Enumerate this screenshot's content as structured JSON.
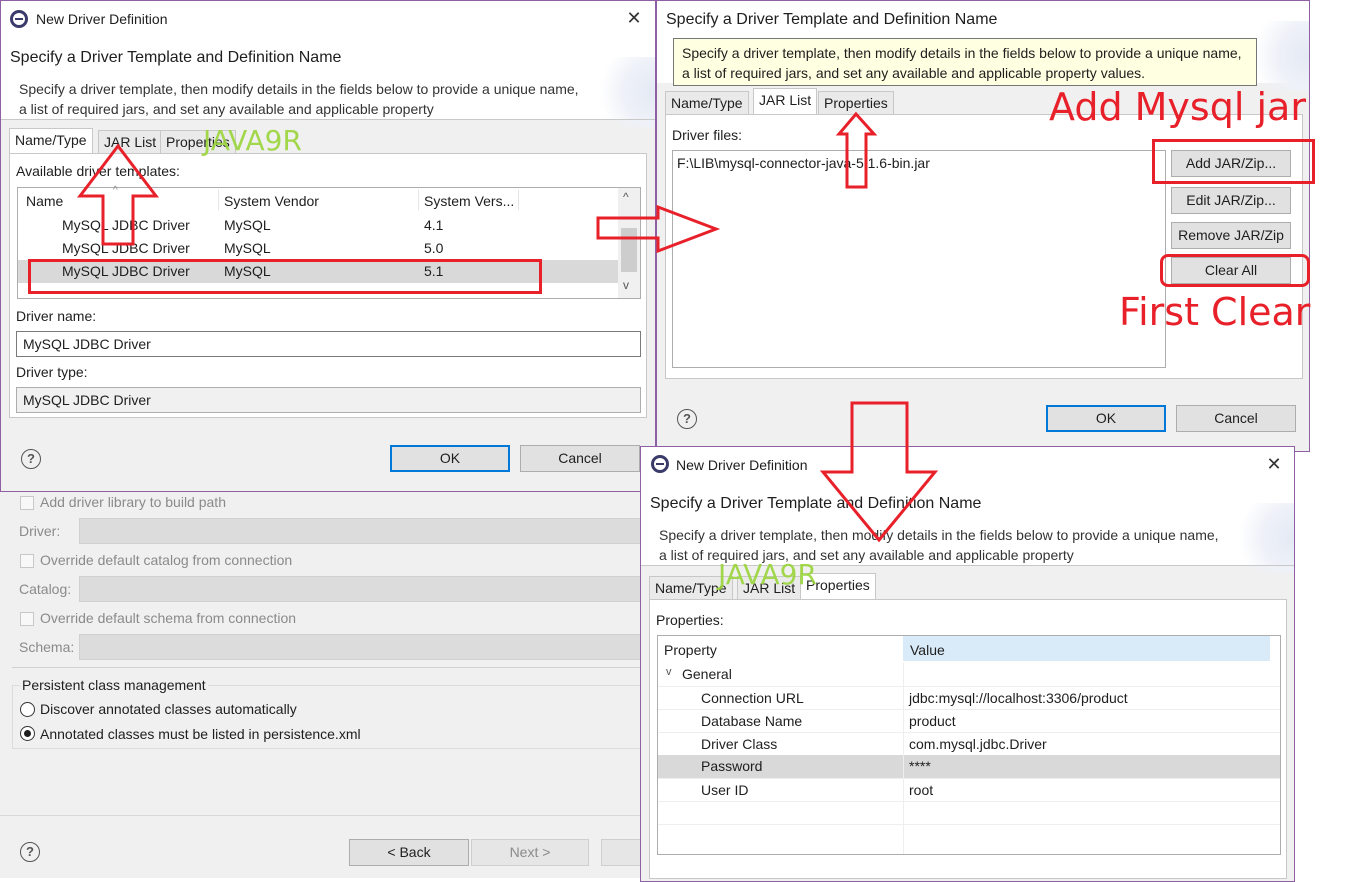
{
  "colors": {
    "annotation_red": "#e8202a",
    "watermark_green": "#9ad53a",
    "focus_blue": "#0078d7",
    "selected_row": "#d9d9d9"
  },
  "watermark": "JAVA9R",
  "annotations": {
    "add_jar": "Add Mysql jar",
    "first_clear": "First Clear"
  },
  "dlg1": {
    "window_title": "New Driver Definition",
    "header_title": "Specify a Driver Template and Definition Name",
    "header_desc": "Specify a driver template, then modify details in the fields below to provide a unique name, a list of required jars, and set any available and applicable property",
    "tabs": [
      "Name/Type",
      "JAR List",
      "Properties"
    ],
    "templates_label": "Available driver templates:",
    "columns": [
      "Name",
      "System Vendor",
      "System Vers..."
    ],
    "rows": [
      {
        "name": "MySQL JDBC Driver",
        "vendor": "MySQL",
        "version": "4.1"
      },
      {
        "name": "MySQL JDBC Driver",
        "vendor": "MySQL",
        "version": "5.0"
      },
      {
        "name": "MySQL JDBC Driver",
        "vendor": "MySQL",
        "version": "5.1"
      }
    ],
    "driver_name_label": "Driver name:",
    "driver_name_value": "MySQL JDBC Driver",
    "driver_type_label": "Driver type:",
    "driver_type_value": "MySQL JDBC Driver",
    "ok": "OK",
    "cancel": "Cancel"
  },
  "background_wizard": {
    "add_lib": "Add driver library to build path",
    "driver_label": "Driver:",
    "override_catalog": "Override default catalog from connection",
    "catalog_label": "Catalog:",
    "override_schema": "Override default schema from connection",
    "schema_label": "Schema:",
    "persistent_group": "Persistent class management",
    "radio_discover": "Discover annotated classes automatically",
    "radio_listed": "Annotated classes must be listed in persistence.xml",
    "back": "< Back",
    "next": "Next >"
  },
  "dlg2": {
    "header_title": "Specify a Driver Template and Definition Name",
    "tooltip": "Specify a driver template, then modify details in the fields below to provide a unique name, a list of required jars, and set any available and applicable property values.",
    "tabs": [
      "Name/Type",
      "JAR List",
      "Properties"
    ],
    "driver_files_label": "Driver files:",
    "files": [
      "F:\\LIB\\mysql-connector-java-5.1.6-bin.jar"
    ],
    "buttons": {
      "add": "Add JAR/Zip...",
      "edit": "Edit JAR/Zip...",
      "remove": "Remove JAR/Zip",
      "clear": "Clear All"
    },
    "ok": "OK",
    "cancel": "Cancel"
  },
  "dlg3": {
    "window_title": "New Driver Definition",
    "header_title": "Specify a Driver Template and Definition Name",
    "header_desc": "Specify a driver template, then modify details in the fields below to provide a unique name, a list of required jars, and set any available and applicable property",
    "tabs": [
      "Name/Type",
      "JAR List",
      "Properties"
    ],
    "properties_label": "Properties:",
    "columns": [
      "Property",
      "Value"
    ],
    "group": "General",
    "props": [
      {
        "name": "Connection URL",
        "value": "jdbc:mysql://localhost:3306/product"
      },
      {
        "name": "Database Name",
        "value": "product"
      },
      {
        "name": "Driver Class",
        "value": "com.mysql.jdbc.Driver"
      },
      {
        "name": "Password",
        "value": "****"
      },
      {
        "name": "User ID",
        "value": "root"
      }
    ]
  }
}
